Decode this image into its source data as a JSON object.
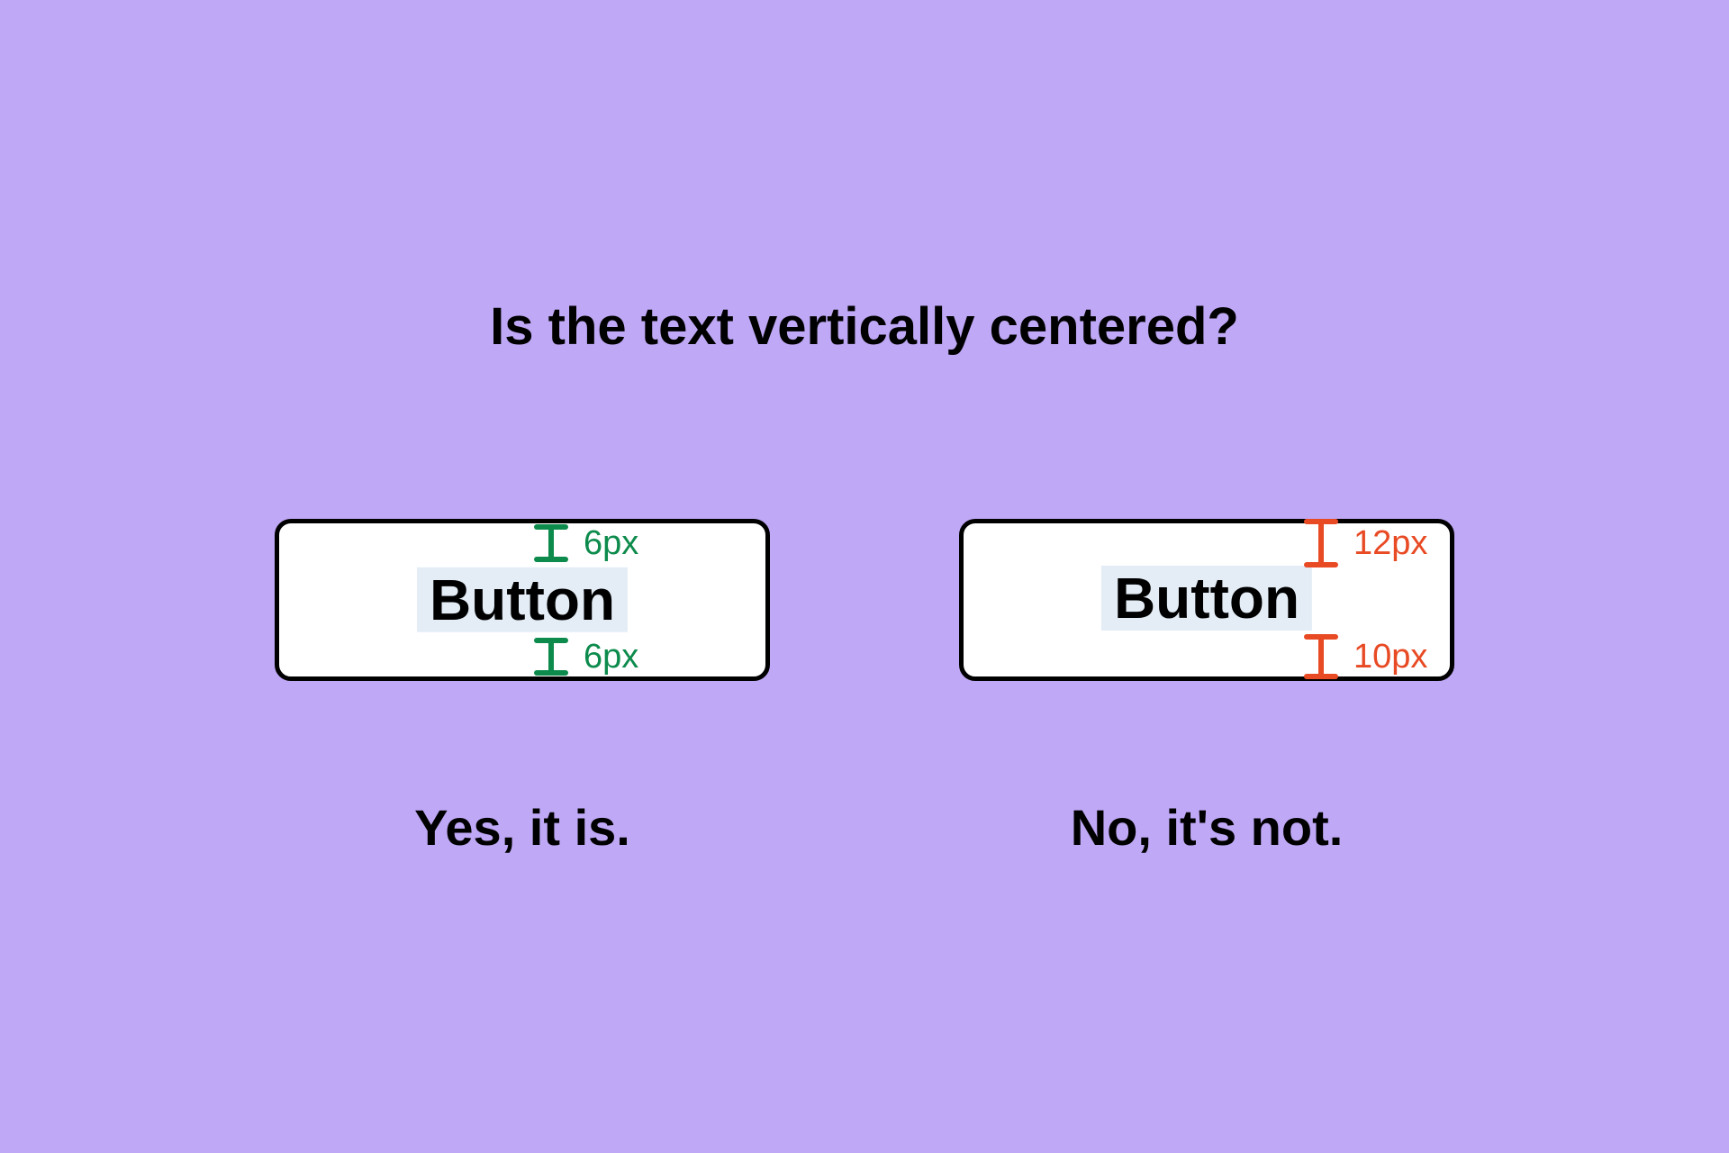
{
  "title": "Is the text vertically centered?",
  "colors": {
    "background": "#bfa8f5",
    "button_bg": "#ffffff",
    "button_border": "#000000",
    "text_highlight": "#e4edf6",
    "measure_correct": "#0d8b4c",
    "measure_incorrect": "#e84a24"
  },
  "examples": {
    "centered": {
      "button_label": "Button",
      "top_measure": "6px",
      "bottom_measure": "6px",
      "caption": "Yes, it is."
    },
    "offset": {
      "button_label": "Button",
      "top_measure": "12px",
      "bottom_measure": "10px",
      "caption": "No, it's not."
    }
  }
}
